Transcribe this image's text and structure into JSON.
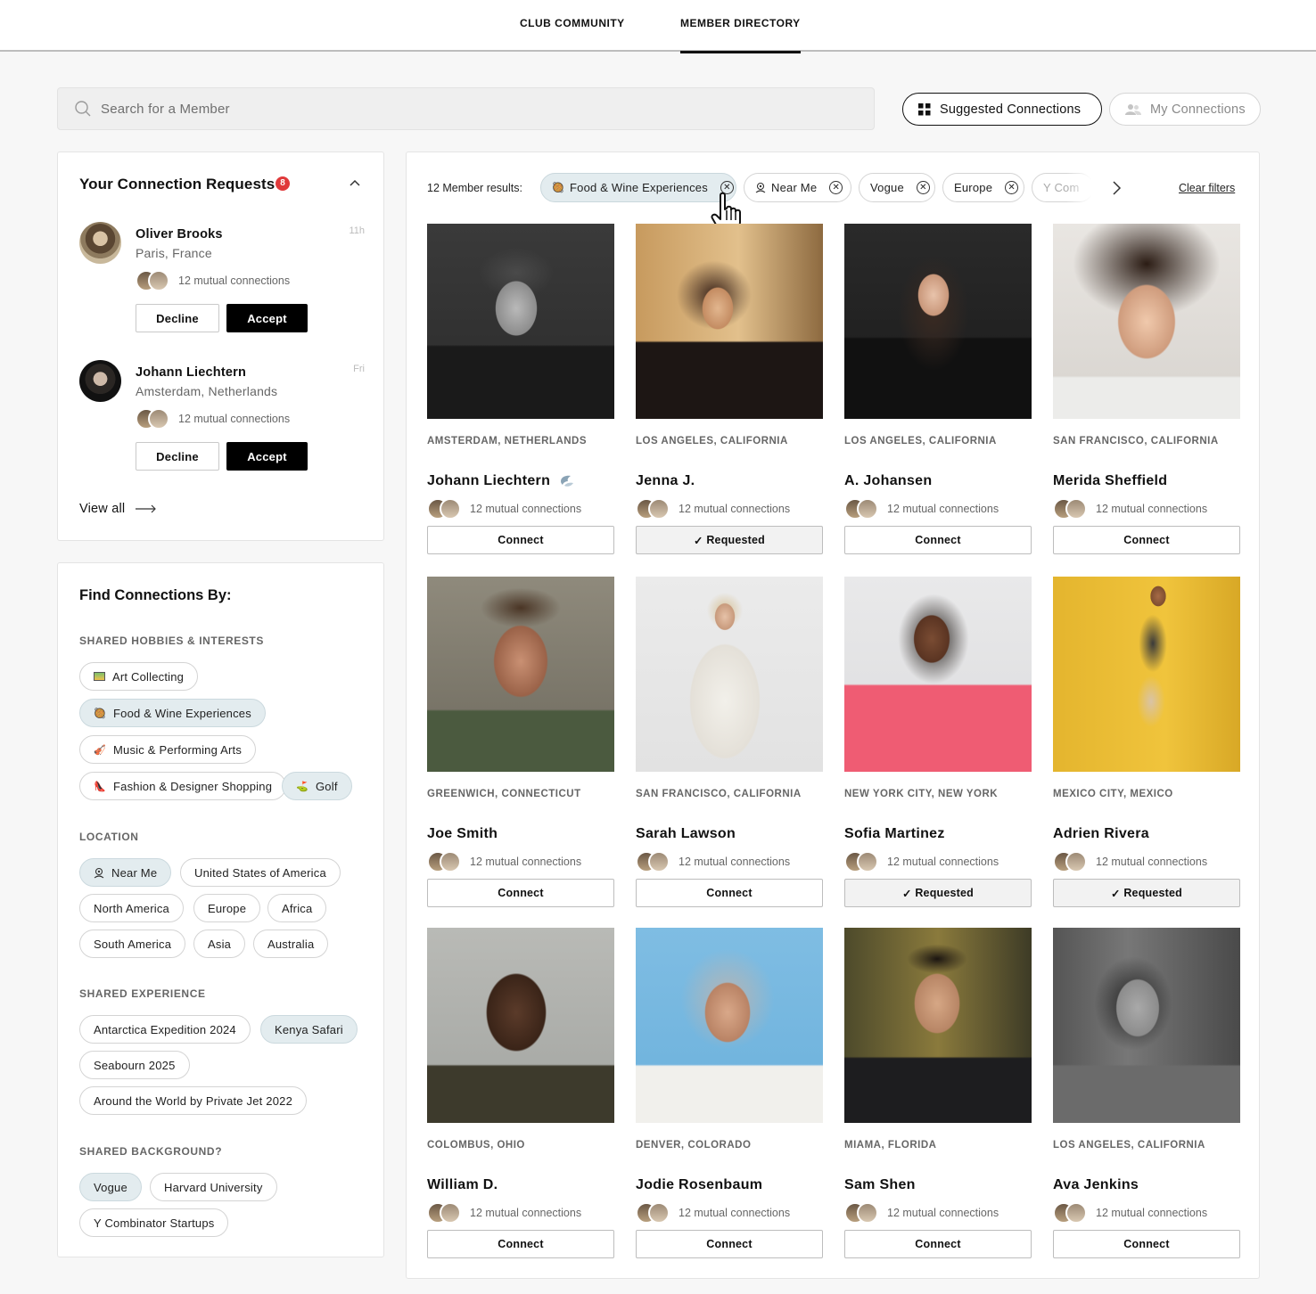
{
  "nav": {
    "tabs": [
      "CLUB COMMUNITY",
      "MEMBER DIRECTORY"
    ],
    "active": "MEMBER DIRECTORY"
  },
  "search": {
    "placeholder": "Search for a Member",
    "value": ""
  },
  "view_buttons": {
    "suggested": "Suggested Connections",
    "my": "My Connections"
  },
  "requests": {
    "title": "Your Connection Requests",
    "count": "8",
    "items": [
      {
        "name": "Oliver Brooks",
        "location": "Paris, France",
        "time": "11h",
        "mutual": "12 mutual connections",
        "decline": "Decline",
        "accept": "Accept"
      },
      {
        "name": "Johann Liechtern",
        "location": "Amsterdam, Netherlands",
        "time": "Fri",
        "mutual": "12 mutual connections",
        "decline": "Decline",
        "accept": "Accept"
      }
    ],
    "view_all": "View all"
  },
  "find": {
    "title": "Find Connections By:",
    "sections": {
      "hobbies": "SHARED HOBBIES & INTERESTS",
      "location": "LOCATION",
      "experience": "SHARED EXPERIENCE",
      "background": "SHARED BACKGROUND?"
    },
    "hobbies": [
      "Art Collecting",
      "Food & Wine Experiences",
      "Music & Performing Arts",
      "Fashion & Designer Shopping",
      "Golf"
    ],
    "locations": [
      "Near Me",
      "United States of America",
      "North America",
      "Europe",
      "Africa",
      "South America",
      "Asia",
      "Australia"
    ],
    "experiences": [
      "Antarctica Expedition 2024",
      "Kenya Safari",
      "Seabourn 2025",
      "Around the World by Private Jet 2022"
    ],
    "backgrounds": [
      "Vogue",
      "Harvard University",
      "Y Combinator Startups"
    ]
  },
  "results": {
    "count_label": "12 Member results:",
    "active_filters": [
      "Food & Wine Experiences",
      "Near Me",
      "Vogue",
      "Europe",
      "Y Com"
    ],
    "clear": "Clear filters",
    "members": [
      {
        "location": "AMSTERDAM, NETHERLANDS",
        "name": "Johann Liechtern",
        "mutual": "12 mutual connections",
        "action": "Connect"
      },
      {
        "location": "LOS ANGELES, CALIFORNIA",
        "name": "Jenna J.",
        "mutual": "12 mutual connections",
        "action": "Requested"
      },
      {
        "location": "LOS ANGELES, CALIFORNIA",
        "name": "A. Johansen",
        "mutual": "12 mutual connections",
        "action": "Connect"
      },
      {
        "location": "SAN FRANCISCO, CALIFORNIA",
        "name": "Merida Sheffield",
        "mutual": "12 mutual connections",
        "action": "Connect"
      },
      {
        "location": "GREENWICH, CONNECTICUT",
        "name": "Joe Smith",
        "mutual": "12 mutual connections",
        "action": "Connect"
      },
      {
        "location": "SAN FRANCISCO, CALIFORNIA",
        "name": "Sarah Lawson",
        "mutual": "12 mutual connections",
        "action": "Connect"
      },
      {
        "location": "NEW YORK CITY, NEW YORK",
        "name": "Sofia Martinez",
        "mutual": "12 mutual connections",
        "action": "Requested"
      },
      {
        "location": "MEXICO CITY, MEXICO",
        "name": "Adrien Rivera",
        "mutual": "12 mutual connections",
        "action": "Requested"
      },
      {
        "location": "COLOMBUS, OHIO",
        "name": "William D.",
        "mutual": "12 mutual connections",
        "action": "Connect"
      },
      {
        "location": "DENVER, COLORADO",
        "name": "Jodie Rosenbaum",
        "mutual": "12 mutual connections",
        "action": "Connect"
      },
      {
        "location": "MIAMA, FLORIDA",
        "name": "Sam Shen",
        "mutual": "12 mutual connections",
        "action": "Connect"
      },
      {
        "location": "LOS ANGELES, CALIFORNIA",
        "name": "Ava Jenkins",
        "mutual": "12 mutual connections",
        "action": "Connect"
      }
    ]
  },
  "colors": {
    "badge": "#e0393a",
    "selected_chip": "#e3ecef",
    "accept": "#000000"
  },
  "icons": [
    "search-icon",
    "grid-icon",
    "people-icon",
    "chevron-up-icon",
    "arrow-right-icon",
    "close-icon",
    "chevron-right-icon",
    "hand-cursor-icon",
    "verified-icon",
    "location-pin-icon"
  ]
}
